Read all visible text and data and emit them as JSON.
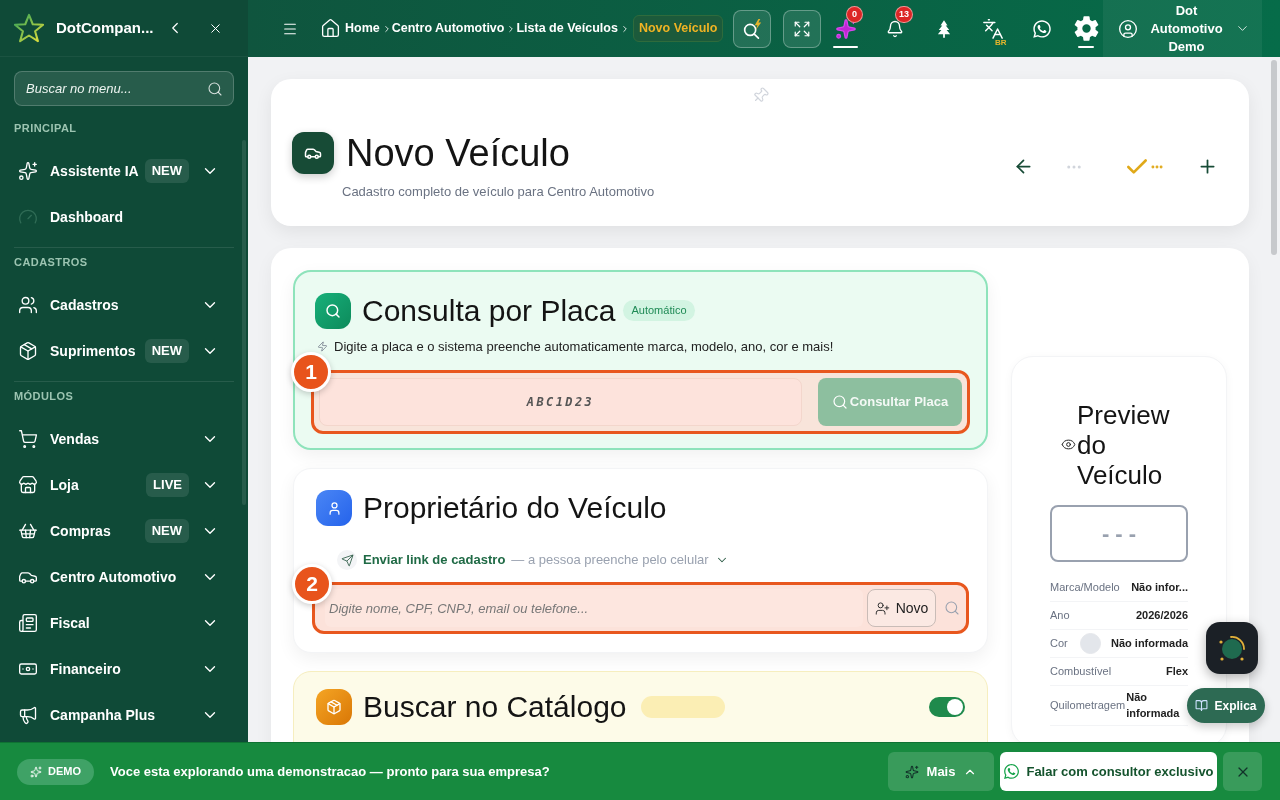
{
  "sidebar": {
    "brand": "DotCompan...",
    "search": {
      "placeholder": "Buscar no menu..."
    },
    "sections": [
      {
        "title": "PRINCIPAL",
        "items": [
          {
            "label": "Assistente IA",
            "badge": "NEW",
            "expandable": true
          },
          {
            "label": "Dashboard",
            "expandable": false
          }
        ]
      },
      {
        "title": "CADASTROS",
        "items": [
          {
            "label": "Cadastros",
            "expandable": true
          },
          {
            "label": "Suprimentos",
            "badge": "NEW",
            "expandable": true
          }
        ]
      },
      {
        "title": "MÓDULOS",
        "items": [
          {
            "label": "Vendas",
            "expandable": true
          },
          {
            "label": "Loja",
            "badge": "LIVE",
            "expandable": true
          },
          {
            "label": "Compras",
            "badge": "NEW",
            "expandable": true
          },
          {
            "label": "Centro Automotivo",
            "expandable": true
          },
          {
            "label": "Fiscal",
            "expandable": true
          },
          {
            "label": "Financeiro",
            "expandable": true
          },
          {
            "label": "Campanha Plus",
            "expandable": true
          }
        ]
      }
    ]
  },
  "topbar": {
    "breadcrumb": [
      {
        "label": "Home",
        "current": false
      },
      {
        "label": "Centro Automotivo",
        "current": false
      },
      {
        "label": "Lista de Veículos",
        "current": false
      },
      {
        "label": "Novo Veículo",
        "current": true
      }
    ],
    "tools": [
      {
        "kind": "boxed",
        "active": false
      },
      {
        "kind": "boxed",
        "active": false
      },
      {
        "kind": "plain",
        "badge": "0",
        "active": true
      },
      {
        "kind": "plain",
        "badge": "13",
        "active": false
      },
      {
        "kind": "plain",
        "active": false
      },
      {
        "kind": "plain",
        "tag": "BR",
        "active": false
      },
      {
        "kind": "plain",
        "active": false
      },
      {
        "kind": "plain",
        "active": true
      }
    ],
    "user": {
      "name": "Dot Automotivo Demo"
    }
  },
  "page_header": {
    "title": "Novo Veículo",
    "subtitle": "Cadastro completo de veículo para Centro Automotivo"
  },
  "plate_lookup": {
    "title": "Consulta por Placa",
    "badge": "Automático",
    "hint": "Digite a placa e o sistema preenche automaticamente marca, modelo, ano, cor e mais!",
    "step": "1",
    "input": {
      "placeholder": "ABC1D23"
    },
    "button": {
      "label": "Consultar Placa",
      "disabled": true
    }
  },
  "owner": {
    "title": "Proprietário do Veículo",
    "send_link": {
      "label": "Enviar link de cadastro",
      "note": "— a pessoa preenche pelo celular"
    },
    "step": "2",
    "search": {
      "placeholder": "Digite nome, CPF, CNPJ, email ou telefone..."
    },
    "new_button": "Novo"
  },
  "catalog": {
    "title": "Buscar no Catálogo",
    "toggle": {
      "on": true
    }
  },
  "preview": {
    "title": "Preview do Veículo",
    "plate": "- - -",
    "fields": [
      {
        "kind": "text",
        "label": "Marca/Modelo",
        "value": "Não infor..."
      },
      {
        "kind": "text",
        "label": "Ano",
        "value": "2026/2026"
      },
      {
        "kind": "swatch",
        "label": "Cor",
        "value": "Não informada"
      },
      {
        "kind": "text",
        "label": "Combustível",
        "value": "Flex"
      },
      {
        "kind": "text",
        "label": "Quilometragem",
        "value": "Não informada"
      }
    ]
  },
  "floating": {
    "explain_button": "Explica"
  },
  "demo_banner": {
    "badge": "DEMO",
    "message": "Voce esta explorando uma demonstracao — pronto para sua empresa?",
    "more_button": "Mais",
    "cta_button": "Falar com consultor exclusivo"
  }
}
